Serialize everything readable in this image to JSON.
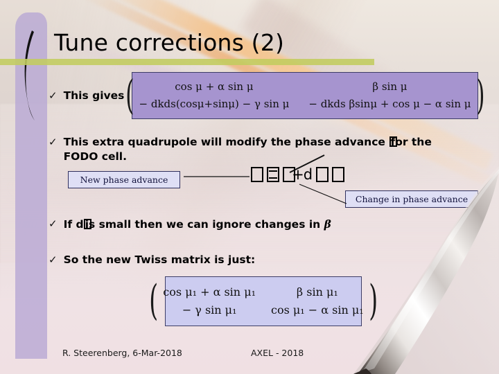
{
  "slide": {
    "title": "Tune corrections (2)",
    "accent_rule_color": "#c2cc5e",
    "left_band_color": "#b8a8d4"
  },
  "matrix_top": {
    "background": "#a694cf",
    "cells": {
      "r1c1": "cos μ + α sin μ",
      "r1c2": "β sin μ",
      "r2c1": "− dkds(cosμ+sinμ) − γ sin μ",
      "r2c2": "− dkds βsinμ + cos μ − α sin μ"
    }
  },
  "matrix_bottom": {
    "background": "#ccccf0",
    "cells": {
      "r1c1": "cos μ₁ + α sin μ₁",
      "r1c2": "β sin μ₁",
      "r2c1": "− γ sin μ₁",
      "r2c2": "cos μ₁ − α sin μ₁"
    }
  },
  "bullets": {
    "tick_glyph": "✓",
    "b1": "This gives",
    "b2_pre": "This extra quadrupole will modify the phase advance ",
    "b2_post": "for the",
    "b2_line2": "FODO cell.",
    "b3_pre": "If d",
    "b3_mid": "is small then we can ignore changes in ",
    "b3_beta": "β",
    "b4": "So the new Twiss matrix is just:"
  },
  "equation_row": {
    "plus": "+",
    "d": "d"
  },
  "callouts": {
    "new_phase_advance": "New phase advance",
    "change_in_phase_advance": "Change in phase advance"
  },
  "footer": {
    "author": "R. Steerenberg, 6-Mar-2018",
    "course": "AXEL - 2018"
  }
}
